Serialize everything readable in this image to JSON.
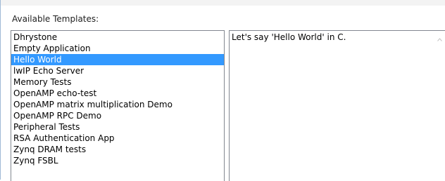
{
  "section_label": "Available Templates:",
  "templates": [
    {
      "label": "Dhrystone",
      "selected": false
    },
    {
      "label": "Empty Application",
      "selected": false
    },
    {
      "label": "Hello World",
      "selected": true
    },
    {
      "label": "lwIP Echo Server",
      "selected": false
    },
    {
      "label": "Memory Tests",
      "selected": false
    },
    {
      "label": "OpenAMP echo-test",
      "selected": false
    },
    {
      "label": "OpenAMP matrix multiplication Demo",
      "selected": false
    },
    {
      "label": "OpenAMP RPC Demo",
      "selected": false
    },
    {
      "label": "Peripheral Tests",
      "selected": false
    },
    {
      "label": "RSA Authentication App",
      "selected": false
    },
    {
      "label": "Zynq DRAM tests",
      "selected": false
    },
    {
      "label": "Zynq FSBL",
      "selected": false
    }
  ],
  "description": "Let's say 'Hello World' in C.",
  "icons": {
    "scroll_up": "chevron-up-icon"
  },
  "colors": {
    "selection": "#3399ff",
    "border": "#828790"
  }
}
